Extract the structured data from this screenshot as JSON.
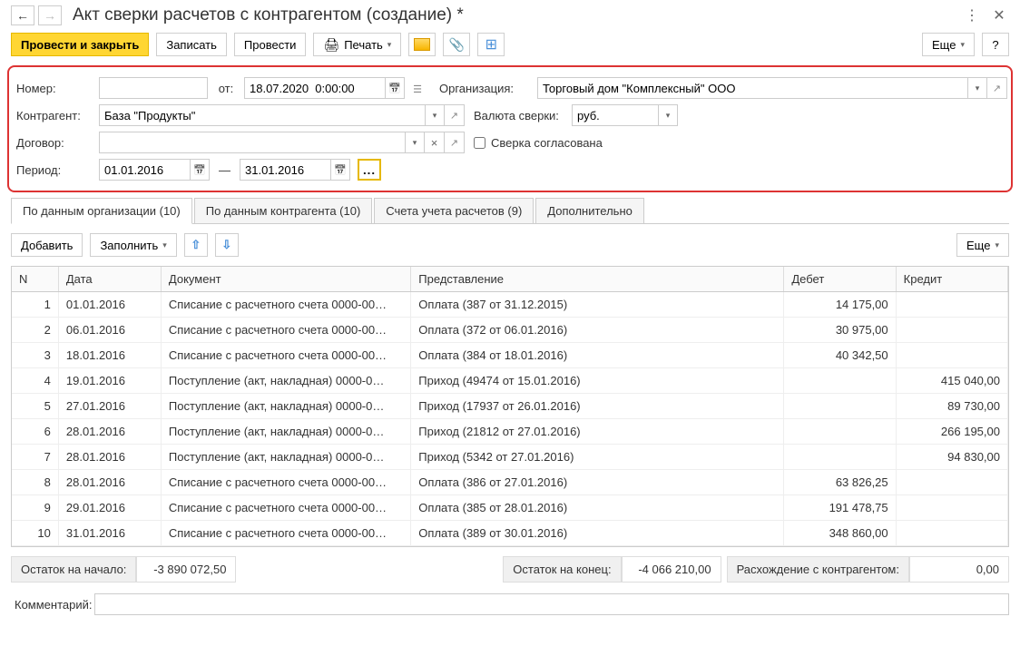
{
  "title": "Акт сверки расчетов с контрагентом (создание) *",
  "toolbar": {
    "post_close": "Провести и закрыть",
    "save": "Записать",
    "post": "Провести",
    "print": "Печать",
    "more": "Еще",
    "help": "?"
  },
  "form": {
    "number_label": "Номер:",
    "number_value": "",
    "from_label": "от:",
    "from_value": "18.07.2020  0:00:00",
    "org_label": "Организация:",
    "org_value": "Торговый дом \"Комплексный\" ООО",
    "contr_label": "Контрагент:",
    "contr_value": "База \"Продукты\"",
    "currency_label": "Валюта сверки:",
    "currency_value": "руб.",
    "contract_label": "Договор:",
    "contract_value": "",
    "agreed_label": "Сверка согласована",
    "period_label": "Период:",
    "period_from": "01.01.2016",
    "period_to": "31.01.2016",
    "period_btn": "..."
  },
  "tabs": [
    "По данным организации (10)",
    "По данным контрагента (10)",
    "Счета учета расчетов (9)",
    "Дополнительно"
  ],
  "table_toolbar": {
    "add": "Добавить",
    "fill": "Заполнить",
    "more": "Еще"
  },
  "columns": {
    "n": "N",
    "date": "Дата",
    "doc": "Документ",
    "repr": "Представление",
    "debit": "Дебет",
    "credit": "Кредит"
  },
  "rows": [
    {
      "n": "1",
      "date": "01.01.2016",
      "doc": "Списание с расчетного счета 0000-00…",
      "repr": "Оплата (387 от 31.12.2015)",
      "debit": "14 175,00",
      "credit": ""
    },
    {
      "n": "2",
      "date": "06.01.2016",
      "doc": "Списание с расчетного счета 0000-00…",
      "repr": "Оплата (372 от 06.01.2016)",
      "debit": "30 975,00",
      "credit": ""
    },
    {
      "n": "3",
      "date": "18.01.2016",
      "doc": "Списание с расчетного счета 0000-00…",
      "repr": "Оплата (384 от 18.01.2016)",
      "debit": "40 342,50",
      "credit": ""
    },
    {
      "n": "4",
      "date": "19.01.2016",
      "doc": "Поступление (акт, накладная) 0000-0…",
      "repr": "Приход (49474 от 15.01.2016)",
      "debit": "",
      "credit": "415 040,00"
    },
    {
      "n": "5",
      "date": "27.01.2016",
      "doc": "Поступление (акт, накладная) 0000-0…",
      "repr": "Приход (17937 от 26.01.2016)",
      "debit": "",
      "credit": "89 730,00"
    },
    {
      "n": "6",
      "date": "28.01.2016",
      "doc": "Поступление (акт, накладная) 0000-0…",
      "repr": "Приход (21812 от 27.01.2016)",
      "debit": "",
      "credit": "266 195,00"
    },
    {
      "n": "7",
      "date": "28.01.2016",
      "doc": "Поступление (акт, накладная) 0000-0…",
      "repr": "Приход (5342 от 27.01.2016)",
      "debit": "",
      "credit": "94 830,00"
    },
    {
      "n": "8",
      "date": "28.01.2016",
      "doc": "Списание с расчетного счета 0000-00…",
      "repr": "Оплата (386 от 27.01.2016)",
      "debit": "63 826,25",
      "credit": ""
    },
    {
      "n": "9",
      "date": "29.01.2016",
      "doc": "Списание с расчетного счета 0000-00…",
      "repr": "Оплата (385 от 28.01.2016)",
      "debit": "191 478,75",
      "credit": ""
    },
    {
      "n": "10",
      "date": "31.01.2016",
      "doc": "Списание с расчетного счета 0000-00…",
      "repr": "Оплата (389 от 30.01.2016)",
      "debit": "348 860,00",
      "credit": ""
    }
  ],
  "summary": {
    "start_label": "Остаток на начало:",
    "start_value": "-3 890 072,50",
    "end_label": "Остаток на конец:",
    "end_value": "-4 066 210,00",
    "diff_label": "Расхождение с контрагентом:",
    "diff_value": "0,00"
  },
  "comment_label": "Комментарий:",
  "comment_value": ""
}
